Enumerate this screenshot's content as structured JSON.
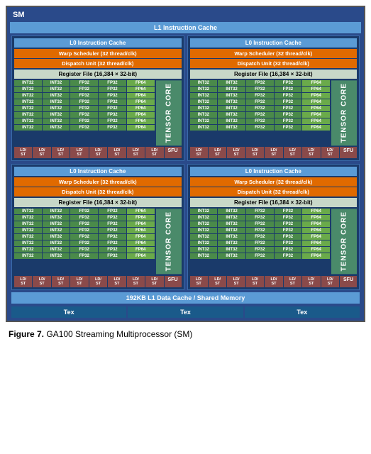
{
  "sm": {
    "title": "SM",
    "l1_instruction_cache": "L1 Instruction Cache",
    "quadrants": [
      {
        "id": "top-left",
        "l0_cache": "L0 Instruction Cache",
        "warp_scheduler": "Warp Scheduler (32 thread/clk)",
        "dispatch_unit": "Dispatch Unit (32 thread/clk)",
        "register_file": "Register File (16,384 × 32-bit)",
        "tensor_core": "TENSOR CORE",
        "rows": [
          [
            "INT32",
            "INT32",
            "FP32",
            "FP32",
            "FP64"
          ],
          [
            "INT32",
            "INT32",
            "FP32",
            "FP32",
            "FP64"
          ],
          [
            "INT32",
            "INT32",
            "FP32",
            "FP32",
            "FP64"
          ],
          [
            "INT32",
            "INT32",
            "FP32",
            "FP32",
            "FP64"
          ],
          [
            "INT32",
            "INT32",
            "FP32",
            "FP32",
            "FP64"
          ],
          [
            "INT32",
            "INT32",
            "FP32",
            "FP32",
            "FP64"
          ],
          [
            "INT32",
            "INT32",
            "FP32",
            "FP32",
            "FP64"
          ],
          [
            "INT32",
            "INT32",
            "FP32",
            "FP32",
            "FP64"
          ]
        ],
        "ld_cells": [
          "LD/ST",
          "LD/ST",
          "LD/ST",
          "LD/ST",
          "LD/ST",
          "LD/ST",
          "LD/ST",
          "LD/ST"
        ],
        "sfu": "SFU"
      },
      {
        "id": "top-right",
        "l0_cache": "L0 Instruction Cache",
        "warp_scheduler": "Warp Scheduler (32 thread/clk)",
        "dispatch_unit": "Dispatch Unit (32 thread/clk)",
        "register_file": "Register File (16,384 × 32-bit)",
        "tensor_core": "TENSOR CORE",
        "rows": [
          [
            "INT32",
            "INT32",
            "FP32",
            "FP32",
            "FP64"
          ],
          [
            "INT32",
            "INT32",
            "FP32",
            "FP32",
            "FP64"
          ],
          [
            "INT32",
            "INT32",
            "FP32",
            "FP32",
            "FP64"
          ],
          [
            "INT32",
            "INT32",
            "FP32",
            "FP32",
            "FP64"
          ],
          [
            "INT32",
            "INT32",
            "FP32",
            "FP32",
            "FP64"
          ],
          [
            "INT32",
            "INT32",
            "FP32",
            "FP32",
            "FP64"
          ],
          [
            "INT32",
            "INT32",
            "FP32",
            "FP32",
            "FP64"
          ],
          [
            "INT32",
            "INT32",
            "FP32",
            "FP32",
            "FP64"
          ]
        ],
        "ld_cells": [
          "LD/ST",
          "LD/ST",
          "LD/ST",
          "LD/ST",
          "LD/ST",
          "LD/ST",
          "LD/ST",
          "LD/ST"
        ],
        "sfu": "SFU"
      },
      {
        "id": "bottom-left",
        "l0_cache": "L0 Instruction Cache",
        "warp_scheduler": "Warp Scheduler (32 thread/clk)",
        "dispatch_unit": "Dispatch Unit (32 thread/clk)",
        "register_file": "Register File (16,384 × 32-bit)",
        "tensor_core": "TENSOR CORE",
        "rows": [
          [
            "INT32",
            "INT32",
            "FP32",
            "FP32",
            "FP64"
          ],
          [
            "INT32",
            "INT32",
            "FP32",
            "FP32",
            "FP64"
          ],
          [
            "INT32",
            "INT32",
            "FP32",
            "FP32",
            "FP64"
          ],
          [
            "INT32",
            "INT32",
            "FP32",
            "FP32",
            "FP64"
          ],
          [
            "INT32",
            "INT32",
            "FP32",
            "FP32",
            "FP64"
          ],
          [
            "INT32",
            "INT32",
            "FP32",
            "FP32",
            "FP64"
          ],
          [
            "INT32",
            "INT32",
            "FP32",
            "FP32",
            "FP64"
          ],
          [
            "INT32",
            "INT32",
            "FP32",
            "FP32",
            "FP64"
          ]
        ],
        "ld_cells": [
          "LD/ST",
          "LD/ST",
          "LD/ST",
          "LD/ST",
          "LD/ST",
          "LD/ST",
          "LD/ST",
          "LD/ST"
        ],
        "sfu": "SFU"
      },
      {
        "id": "bottom-right",
        "l0_cache": "L0 Instruction Cache",
        "warp_scheduler": "Warp Scheduler (32 thread/clk)",
        "dispatch_unit": "Dispatch Unit (32 thread/clk)",
        "register_file": "Register File (16,384 × 32-bit)",
        "tensor_core": "TENSOR CORE",
        "rows": [
          [
            "INT32",
            "INT32",
            "FP32",
            "FP32",
            "FP64"
          ],
          [
            "INT32",
            "INT32",
            "FP32",
            "FP32",
            "FP64"
          ],
          [
            "INT32",
            "INT32",
            "FP32",
            "FP32",
            "FP64"
          ],
          [
            "INT32",
            "INT32",
            "FP32",
            "FP32",
            "FP64"
          ],
          [
            "INT32",
            "INT32",
            "FP32",
            "FP32",
            "FP64"
          ],
          [
            "INT32",
            "INT32",
            "FP32",
            "FP32",
            "FP64"
          ],
          [
            "INT32",
            "INT32",
            "FP32",
            "FP32",
            "FP64"
          ],
          [
            "INT32",
            "INT32",
            "FP32",
            "FP32",
            "FP64"
          ]
        ],
        "ld_cells": [
          "LD/ST",
          "LD/ST",
          "LD/ST",
          "LD/ST",
          "LD/ST",
          "LD/ST",
          "LD/ST",
          "LD/ST"
        ],
        "sfu": "SFU"
      }
    ],
    "l1_data_cache": "192KB L1 Data Cache / Shared Memory",
    "tex_labels": [
      "Tex",
      "Tex",
      "Tex"
    ]
  },
  "caption": {
    "figure_num": "Figure 7.",
    "description": "   GA100 Streaming Multiprocessor (SM)"
  }
}
